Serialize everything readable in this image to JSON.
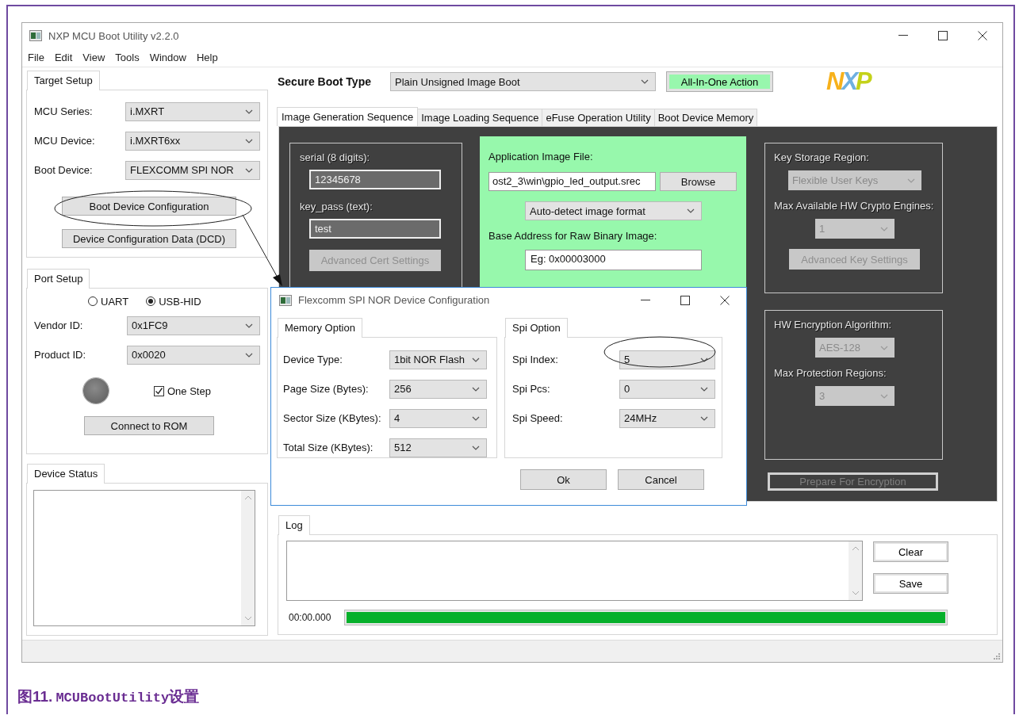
{
  "window": {
    "title": "NXP MCU Boot Utility v2.2.0"
  },
  "menu": [
    "File",
    "Edit",
    "View",
    "Tools",
    "Window",
    "Help"
  ],
  "target_setup": {
    "title": "Target Setup",
    "fields": [
      {
        "label": "MCU Series:",
        "value": "i.MXRT"
      },
      {
        "label": "MCU Device:",
        "value": "i.MXRT6xx"
      },
      {
        "label": "Boot Device:",
        "value": "FLEXCOMM SPI NOR"
      }
    ],
    "buttons": [
      "Boot Device Configuration",
      "Device Configuration Data (DCD)"
    ]
  },
  "port_setup": {
    "title": "Port Setup",
    "ports": [
      {
        "label": "UART",
        "selected": false
      },
      {
        "label": "USB-HID",
        "selected": true
      }
    ],
    "fields": [
      {
        "label": "Vendor ID:",
        "value": "0x1FC9"
      },
      {
        "label": "Product ID:",
        "value": "0x0020"
      }
    ],
    "one_step": {
      "label": "One Step",
      "checked": true
    },
    "connect_button": "Connect to ROM"
  },
  "device_status": {
    "title": "Device Status"
  },
  "secure_boot": {
    "label": "Secure Boot Type",
    "value": "Plain Unsigned Image Boot",
    "action_button": "All-In-One Action"
  },
  "logo": "NXP",
  "tabs": [
    {
      "label": "Image Generation Sequence",
      "selected": true
    },
    {
      "label": "Image Loading Sequence",
      "selected": false
    },
    {
      "label": "eFuse Operation Utility",
      "selected": false
    },
    {
      "label": "Boot Device Memory",
      "selected": false
    }
  ],
  "cert_panel": {
    "fields": [
      {
        "label": "serial (8 digits):",
        "value": "12345678"
      },
      {
        "label": "key_pass (text):",
        "value": "test"
      }
    ],
    "button": {
      "label": "Advanced Cert Settings",
      "disabled": true
    }
  },
  "image_panel": {
    "file_label": "Application Image File:",
    "file_value": "ost2_3\\win\\gpio_led_output.srec",
    "browse_button": "Browse",
    "format": "Auto-detect image format",
    "base_label": "Base Address for Raw Binary Image:",
    "base_value": "Eg: 0x00003000"
  },
  "key_panel": {
    "fields": [
      {
        "label": "Key Storage Region:",
        "value": "Flexible User Keys",
        "disabled": true
      },
      {
        "label": "Max Available HW Crypto Engines:",
        "value": "1",
        "disabled": true
      }
    ],
    "button": {
      "label": "Advanced Key Settings",
      "disabled": true
    }
  },
  "encryption_panel": {
    "fields": [
      {
        "label": "HW Encryption Algorithm:",
        "value": "AES-128",
        "disabled": true
      },
      {
        "label": "Max Protection Regions:",
        "value": "3",
        "disabled": true
      }
    ],
    "button": {
      "label": "Prepare For Encryption",
      "disabled": true
    }
  },
  "log": {
    "title": "Log",
    "buttons": [
      "Clear",
      "Save"
    ],
    "time": "00:00.000",
    "level": 1
  },
  "dialog": {
    "title": "Flexcomm SPI NOR Device Configuration",
    "memory": {
      "title": "Memory Option",
      "fields": [
        {
          "label": "Device Type:",
          "value": "1bit NOR Flash"
        },
        {
          "label": "Page Size (Bytes):",
          "value": "256"
        },
        {
          "label": "Sector Size (KBytes):",
          "value": "4"
        },
        {
          "label": "Total Size (KBytes):",
          "value": "512"
        }
      ]
    },
    "spi": {
      "title": "Spi Option",
      "fields": [
        {
          "label": "Spi Index:",
          "value": "5"
        },
        {
          "label": "Spi Pcs:",
          "value": "0"
        },
        {
          "label": "Spi Speed:",
          "value": "24MHz"
        }
      ]
    },
    "buttons": [
      "Ok",
      "Cancel"
    ]
  },
  "caption": {
    "number": "图11.",
    "code": "MCUBootUtility",
    "text": "设置"
  }
}
